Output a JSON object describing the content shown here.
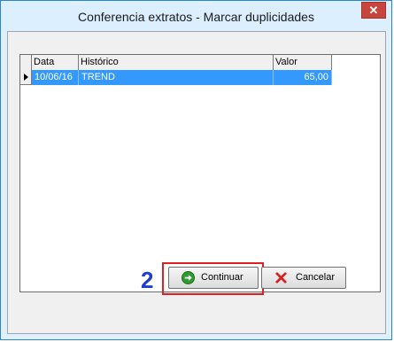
{
  "window": {
    "title": "Conferencia extratos - Marcar duplicidades",
    "close_label": "✕"
  },
  "grid": {
    "columns": [
      "Data",
      "Histórico",
      "Valor"
    ],
    "rows": [
      {
        "data": "10/06/16",
        "historico": "TREND",
        "valor": "65,00",
        "selected": true
      }
    ]
  },
  "annotation": {
    "step_number": "2",
    "highlight_color": "#e02020",
    "number_color": "#1e3cd6"
  },
  "buttons": {
    "continuar_label": "Continuar",
    "continuar_icon": "green-arrow-right-icon",
    "cancelar_label": "Cancelar",
    "cancelar_icon": "red-x-icon"
  },
  "colors": {
    "selection": "#3399ff",
    "close_button": "#c8453d",
    "title_bar": "#dcefff"
  }
}
